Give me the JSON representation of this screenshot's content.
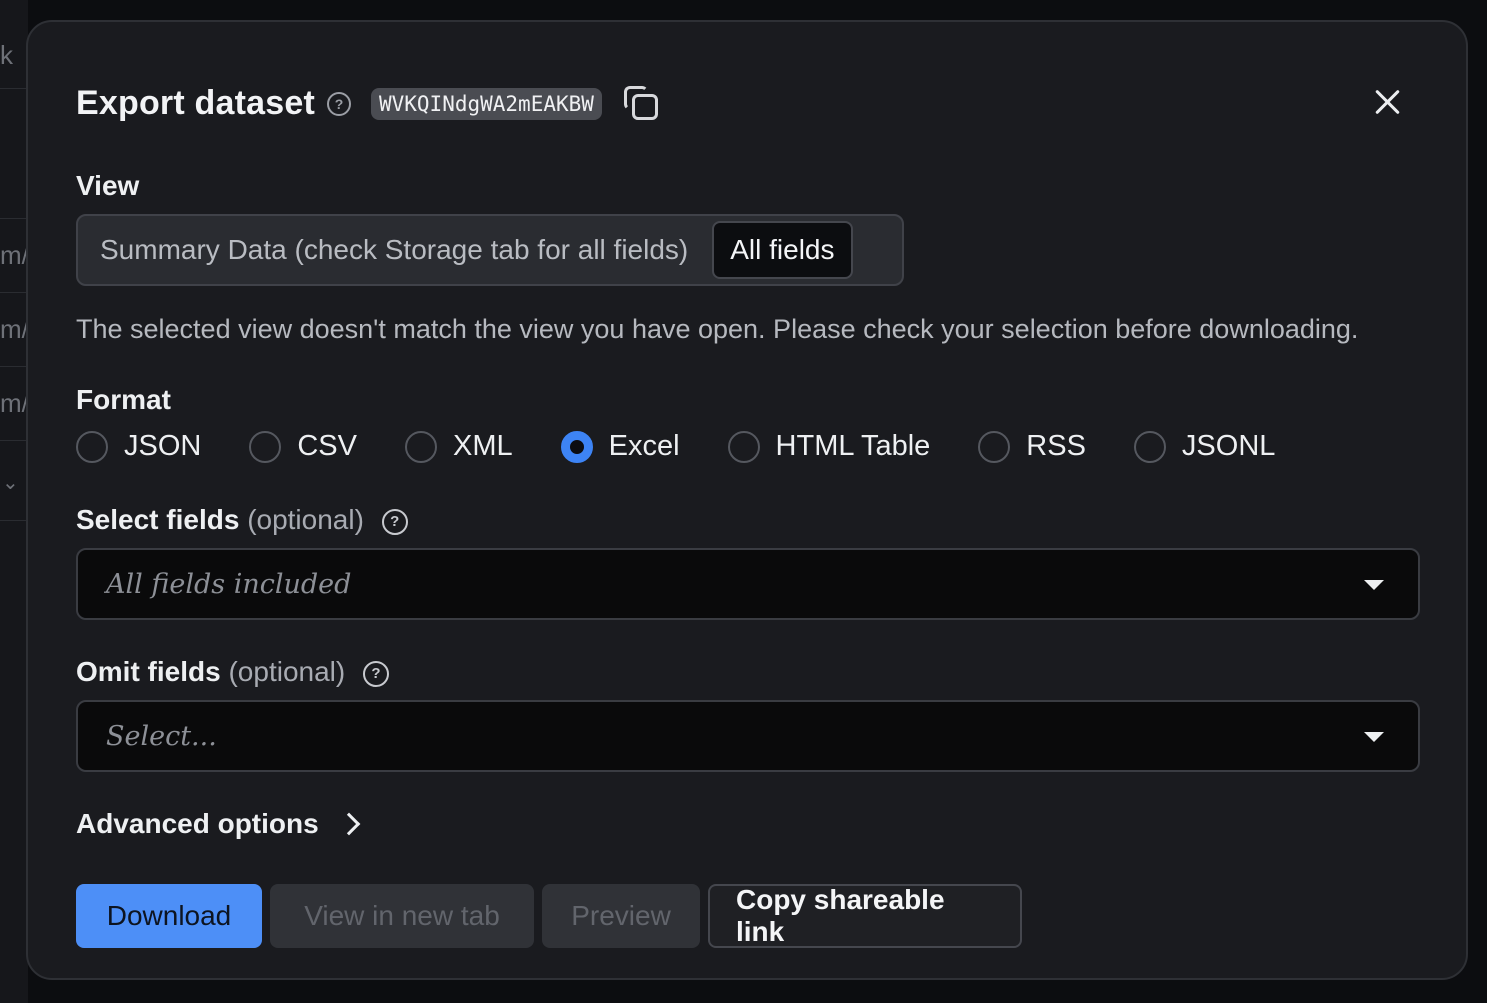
{
  "background": {
    "fragments": [
      "k",
      "m/",
      "m/",
      "m/"
    ]
  },
  "modal": {
    "title": "Export dataset",
    "dataset_id": "WVKQINdgWA2mEAKBW"
  },
  "view": {
    "label": "View",
    "options": [
      "Summary Data (check Storage tab for all fields)",
      "All fields"
    ],
    "selected": "All fields",
    "warning": "The selected view doesn't match the view you have open. Please check your selection before downloading."
  },
  "format": {
    "label": "Format",
    "options": [
      "JSON",
      "CSV",
      "XML",
      "Excel",
      "HTML Table",
      "RSS",
      "JSONL"
    ],
    "selected": "Excel"
  },
  "select_fields": {
    "label": "Select fields",
    "optional": "(optional)",
    "placeholder": "All fields included"
  },
  "omit_fields": {
    "label": "Omit fields",
    "optional": "(optional)",
    "placeholder": "Select..."
  },
  "advanced": {
    "label": "Advanced options"
  },
  "actions": {
    "download": "Download",
    "view_new_tab": "View in new tab",
    "preview": "Preview",
    "copy_link": "Copy shareable link"
  },
  "colors": {
    "accent": "#4d8ff7",
    "modal_bg": "#1a1b1f",
    "page_bg": "#0c0d10"
  }
}
